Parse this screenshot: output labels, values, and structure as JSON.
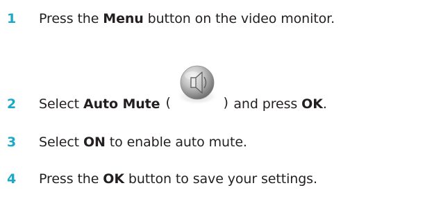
{
  "steps": [
    {
      "number": "1",
      "before": "Press the ",
      "bold": "Menu",
      "after": " button on the video monitor."
    },
    {
      "number": "2",
      "before": "Select ",
      "bold": "Auto Mute",
      "paren_open": "(",
      "icon": "speaker-icon",
      "paren_close": ")",
      "middle": " and press ",
      "bold2": "OK",
      "after": "."
    },
    {
      "number": "3",
      "before": "Select ",
      "bold": "ON",
      "after": " to enable auto mute."
    },
    {
      "number": "4",
      "before": "Press the ",
      "bold": "OK",
      "after": " button to save your settings."
    }
  ],
  "colors": {
    "step_number": "#1ba9c9",
    "text": "#231f20"
  }
}
